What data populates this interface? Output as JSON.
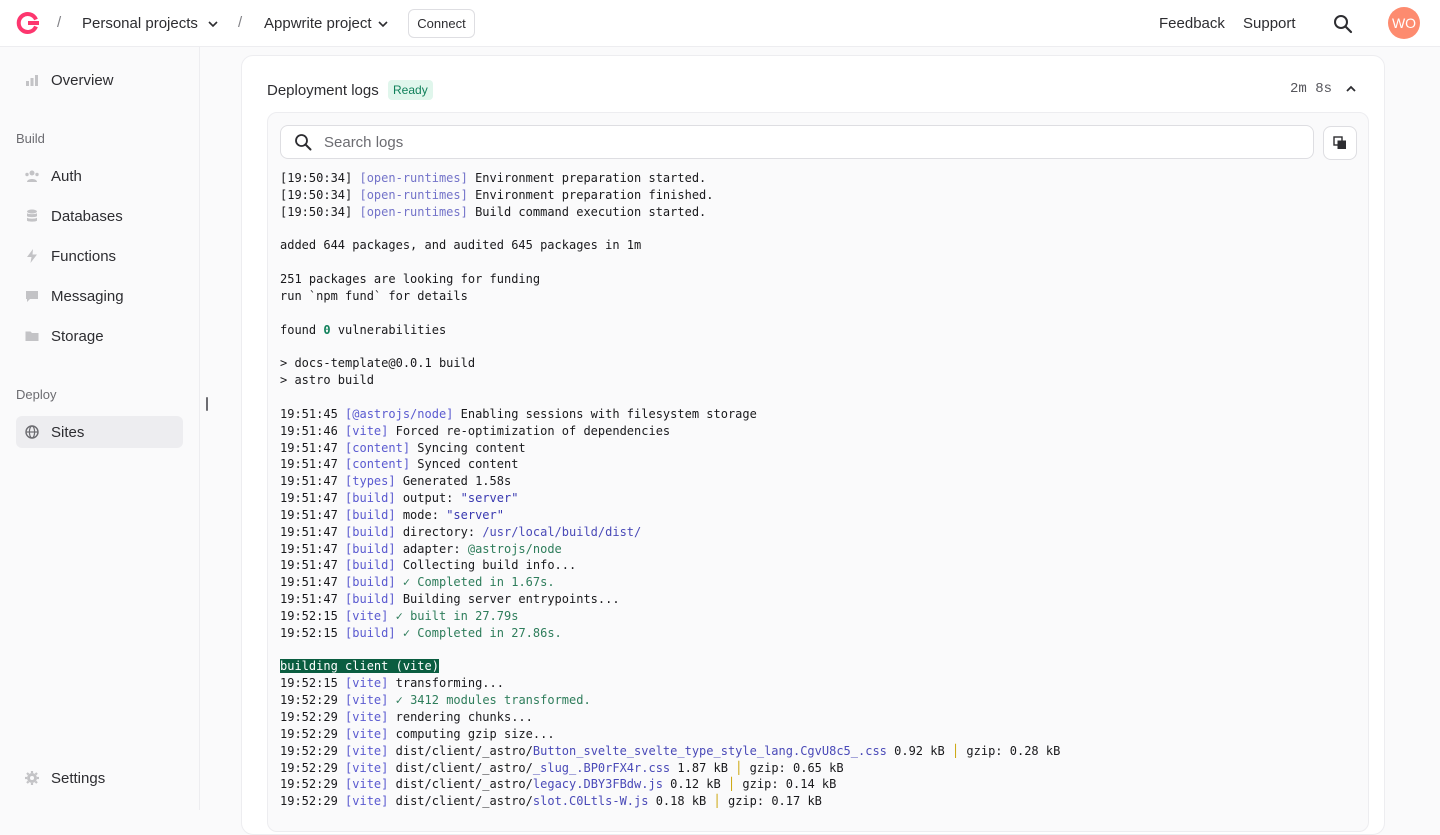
{
  "header": {
    "breadcrumbs": [
      "Personal projects",
      "Appwrite project"
    ],
    "connect_label": "Connect",
    "links": [
      "Feedback",
      "Support"
    ],
    "avatar_initials": "WO"
  },
  "sidebar": {
    "overview": "Overview",
    "build_section": "Build",
    "build_items": [
      "Auth",
      "Databases",
      "Functions",
      "Messaging",
      "Storage"
    ],
    "deploy_section": "Deploy",
    "deploy_items": [
      "Sites"
    ],
    "settings": "Settings"
  },
  "deployment": {
    "title": "Deployment logs",
    "status": "Ready",
    "duration": "2m 8s",
    "search_placeholder": "Search logs"
  },
  "logs": [
    "[19:50:34] [open-runtimes] Environment preparation started.",
    "[19:50:34] [open-runtimes] Environment preparation finished.",
    "[19:50:34] [open-runtimes] Build command execution started.",
    "",
    "added 644 packages, and audited 645 packages in 1m",
    "",
    "251 packages are looking for funding",
    "run `npm fund` for details",
    "",
    "found 0 vulnerabilities",
    "",
    "> docs-template@0.0.1 build",
    "> astro build",
    "",
    "19:51:45 [@astrojs/node] Enabling sessions with filesystem storage",
    "19:51:46 [vite] Forced re-optimization of dependencies",
    "19:51:47 [content] Syncing content",
    "19:51:47 [content] Synced content",
    "19:51:47 [types] Generated 1.58s",
    "19:51:47 [build] output: \"server\"",
    "19:51:47 [build] mode: \"server\"",
    "19:51:47 [build] directory: /usr/local/build/dist/",
    "19:51:47 [build] adapter: @astrojs/node",
    "19:51:47 [build] Collecting build info...",
    "19:51:47 [build] ✓ Completed in 1.67s.",
    "19:51:47 [build] Building server entrypoints...",
    "19:52:15 [vite] ✓ built in 27.79s",
    "19:52:15 [build] ✓ Completed in 27.86s.",
    "",
    "building client (vite)",
    "19:52:15 [vite] transforming...",
    "19:52:29 [vite] ✓ 3412 modules transformed.",
    "19:52:29 [vite] rendering chunks...",
    "19:52:29 [vite] computing gzip size...",
    "19:52:29 [vite] dist/client/_astro/Button_svelte_svelte_type_style_lang.CgvU8c5_.css 0.92 kB │ gzip: 0.28 kB",
    "19:52:29 [vite] dist/client/_astro/_slug_.BP0rFX4r.css 1.87 kB │ gzip: 0.65 kB",
    "19:52:29 [vite] dist/client/_astro/legacy.DBY3FBdw.js 0.12 kB │ gzip: 0.14 kB",
    "19:52:29 [vite] dist/client/_astro/slot.C0Ltls-W.js 0.18 kB │ gzip: 0.17 kB"
  ],
  "colors": {
    "accent": "#fd366e",
    "ready_badge_bg": "#e0f6ec",
    "ready_badge_text": "#10805a",
    "avatar_bg": "#fd8b6f"
  }
}
